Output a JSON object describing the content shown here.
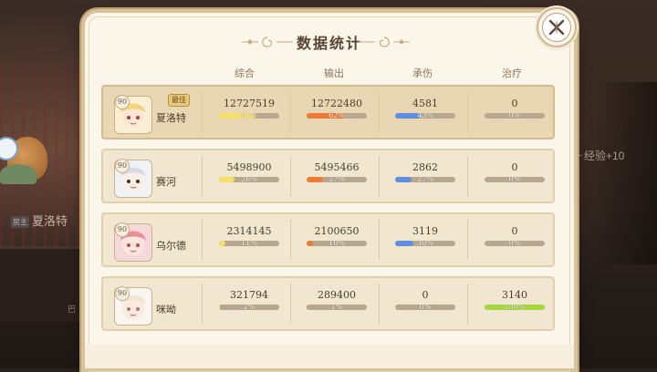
{
  "background": {
    "player_name": "夏洛特",
    "player_tag": "房主",
    "small_label": "巴",
    "exp_text": "经验+10"
  },
  "dialog": {
    "title": "数据统计",
    "close_icon": "close-x-icon"
  },
  "columns": [
    "综合",
    "输出",
    "承伤",
    "治疗"
  ],
  "colors": {
    "total": "#f7df6a",
    "damage": "#ef7a35",
    "tank": "#5f8ee0",
    "heal": "#a5d63d",
    "row_highlight": "#e9d7b3",
    "row_normal": "#f1e6cf"
  },
  "players": [
    {
      "name": "夏洛特",
      "level": "90",
      "badge": "最佳",
      "highlight": true,
      "avatar": "blonde-girl-avatar",
      "stats": [
        {
          "value": "12727519",
          "percent": "61%",
          "fraction": 0.61
        },
        {
          "value": "12722480",
          "percent": "62%",
          "fraction": 0.62
        },
        {
          "value": "4581",
          "percent": "43%",
          "fraction": 0.43
        },
        {
          "value": "0",
          "percent": "0%",
          "fraction": 0
        }
      ]
    },
    {
      "name": "赛河",
      "level": "90",
      "badge": "",
      "highlight": false,
      "avatar": "glasses-hat-avatar",
      "stats": [
        {
          "value": "5498900",
          "percent": "26%",
          "fraction": 0.26
        },
        {
          "value": "5495466",
          "percent": "27%",
          "fraction": 0.27
        },
        {
          "value": "2862",
          "percent": "27%",
          "fraction": 0.27
        },
        {
          "value": "0",
          "percent": "0%",
          "fraction": 0
        }
      ]
    },
    {
      "name": "乌尔德",
      "level": "90",
      "badge": "",
      "highlight": false,
      "avatar": "pink-hair-avatar",
      "stats": [
        {
          "value": "2314145",
          "percent": "11%",
          "fraction": 0.11
        },
        {
          "value": "2100650",
          "percent": "10%",
          "fraction": 0.1
        },
        {
          "value": "3119",
          "percent": "30%",
          "fraction": 0.3
        },
        {
          "value": "0",
          "percent": "0%",
          "fraction": 0
        }
      ]
    },
    {
      "name": "咪呦",
      "level": "90",
      "badge": "",
      "highlight": false,
      "avatar": "white-hair-avatar",
      "stats": [
        {
          "value": "321794",
          "percent": "2%",
          "fraction": 0.02
        },
        {
          "value": "289400",
          "percent": "1%",
          "fraction": 0.01
        },
        {
          "value": "0",
          "percent": "0%",
          "fraction": 0
        },
        {
          "value": "3140",
          "percent": "100%",
          "fraction": 1.0
        }
      ]
    }
  ]
}
